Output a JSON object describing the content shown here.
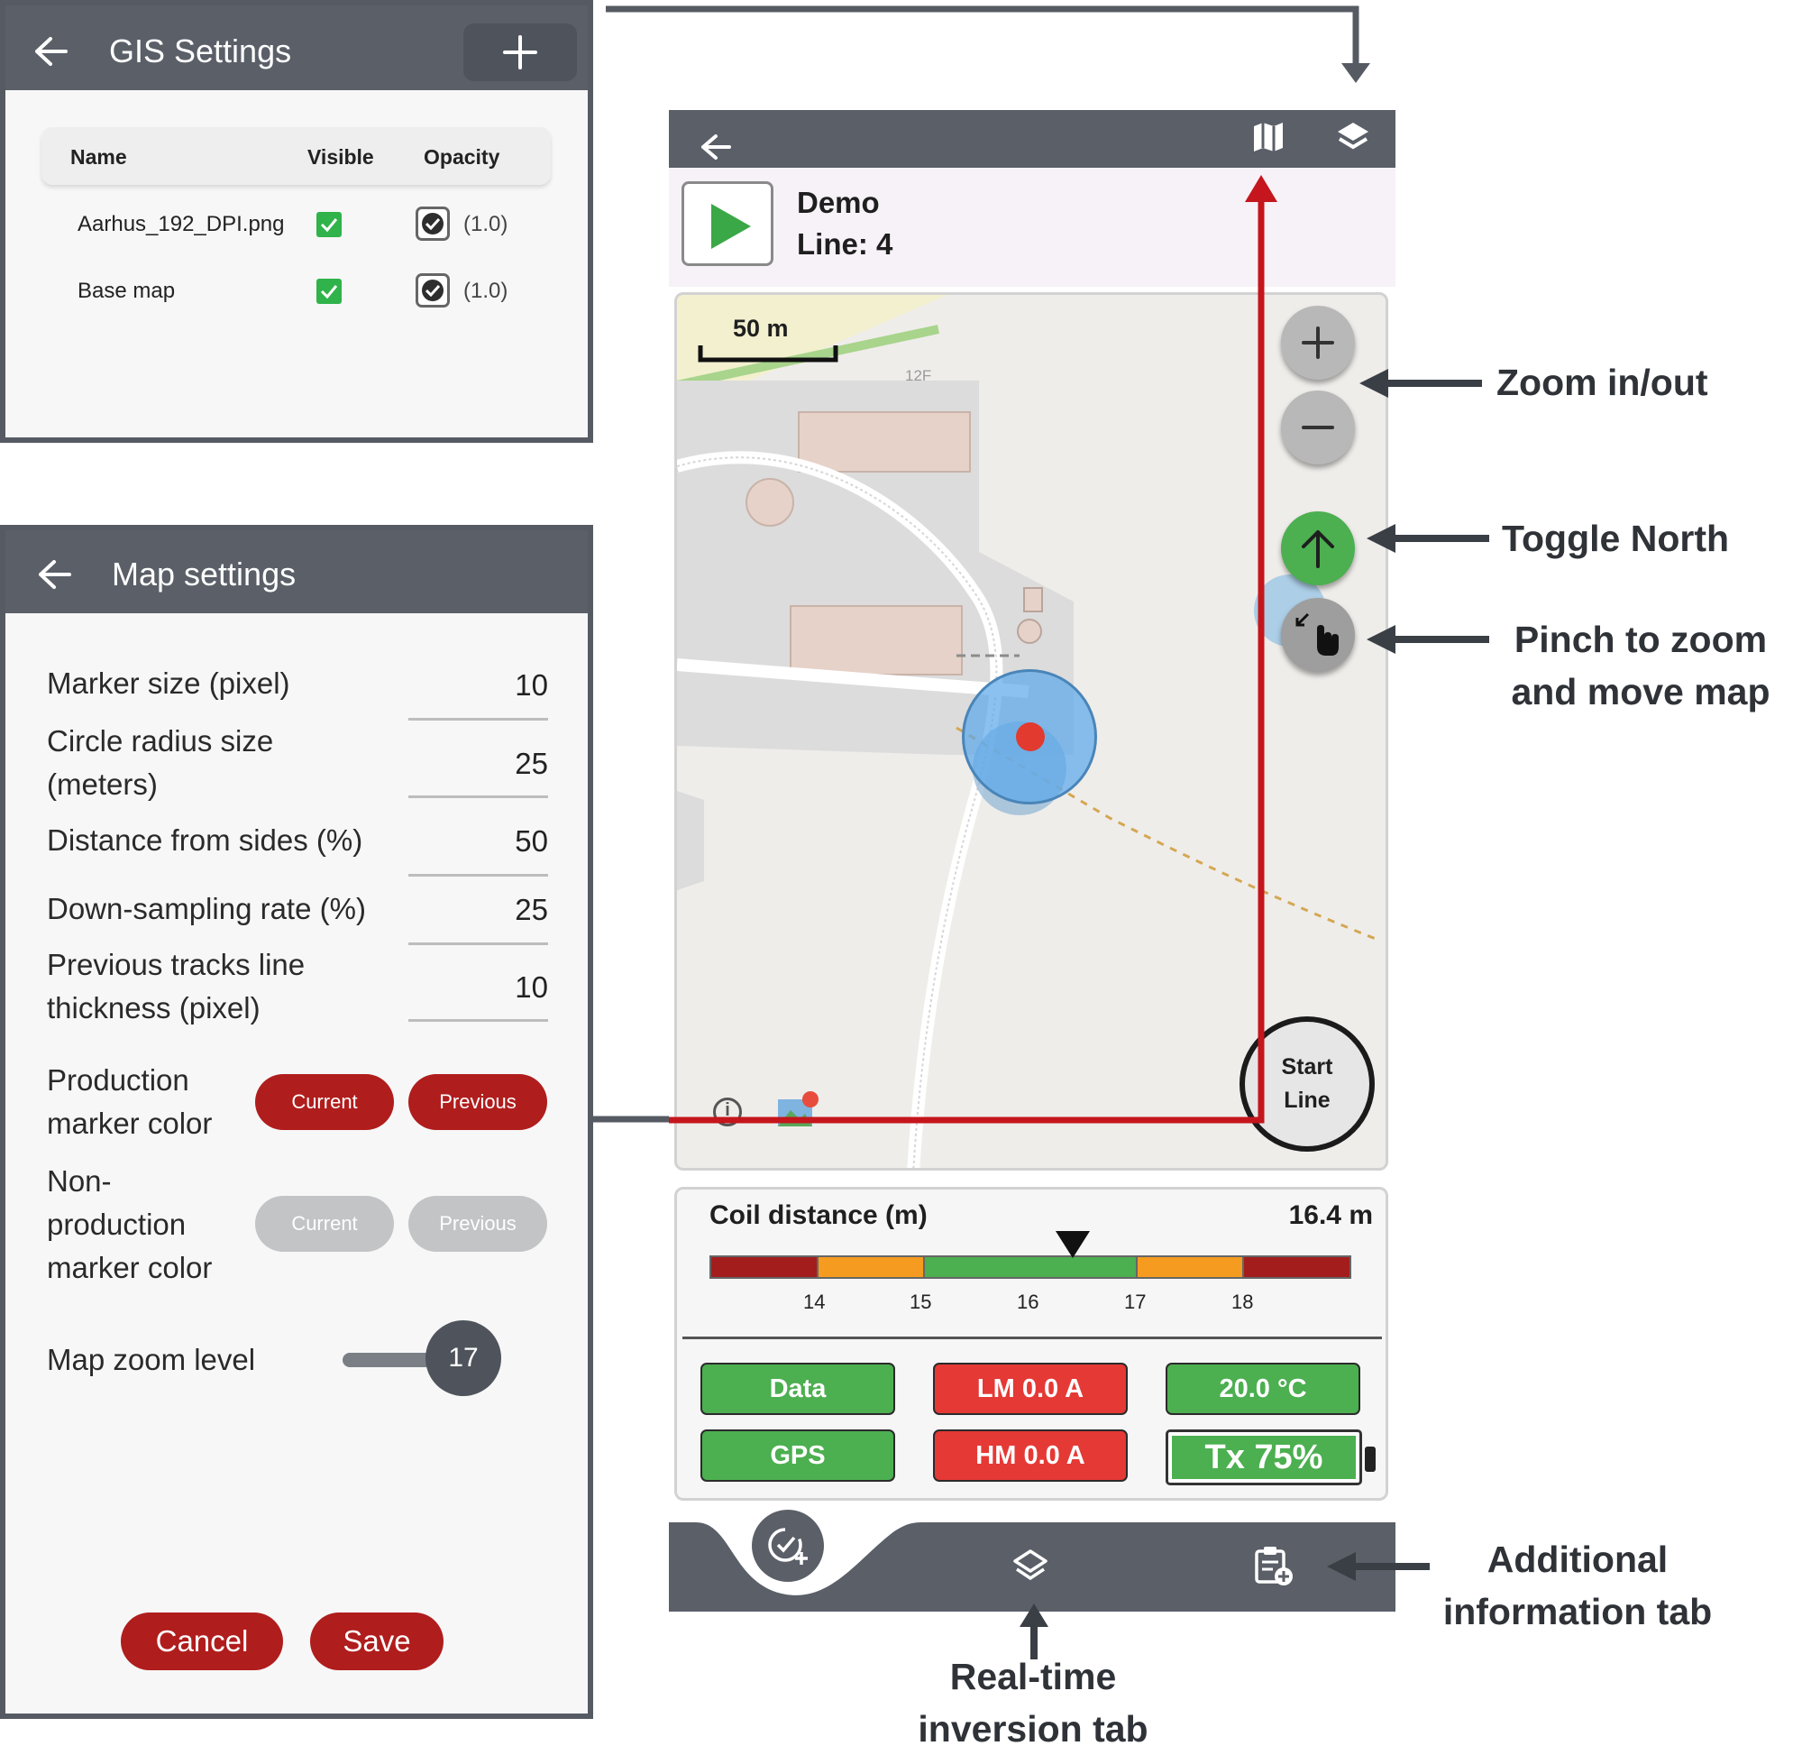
{
  "gis": {
    "title": "GIS Settings",
    "add_icon": "plus-icon",
    "columns": [
      "Name",
      "Visible",
      "Opacity"
    ],
    "layers": [
      {
        "name": "Aarhus_192_DPI.png",
        "visible": true,
        "opacity": "(1.0)"
      },
      {
        "name": "Base map",
        "visible": true,
        "opacity": "(1.0)"
      }
    ]
  },
  "map_settings": {
    "title": "Map settings",
    "fields": [
      {
        "label": "Marker size (pixel)",
        "value": "10"
      },
      {
        "label": "Circle radius size (meters)",
        "value": "25"
      },
      {
        "label": "Distance from sides (%)",
        "value": "50"
      },
      {
        "label": "Down-sampling rate (%)",
        "value": "25"
      },
      {
        "label": "Previous tracks line thickness (pixel)",
        "value": "10"
      }
    ],
    "production_label": "Production marker color",
    "nonproduction_label": "Non-production marker color",
    "current_label": "Current",
    "previous_label": "Previous",
    "zoom_label": "Map zoom level",
    "zoom_value": "17",
    "zoom_fraction": 1.0,
    "cancel_label": "Cancel",
    "save_label": "Save",
    "colors": {
      "production": "#b01d1d",
      "nonproduction": "#c2c4c6"
    }
  },
  "app": {
    "survey_name": "Demo",
    "line_label": "Line: 4",
    "scale_label": "50 m",
    "map_label": "12F",
    "start_line_label": "Start Line",
    "coil_label": "Coil distance (m)",
    "coil_value": "16.4 m",
    "coil_ticks": [
      "14",
      "15",
      "16",
      "17",
      "18"
    ],
    "coil_reading": 16.4,
    "coil_range": [
      13,
      19
    ],
    "status": {
      "data": "Data",
      "gps": "GPS",
      "lm": "LM 0.0 A",
      "hm": "HM 0.0 A",
      "temp": "20.0 °C",
      "tx": "Tx 75%"
    },
    "colors": {
      "ok": "#4caf50",
      "error": "#e53935",
      "header": "#5a5f68"
    }
  },
  "annotations": {
    "zoom": "Zoom in/out",
    "north": "Toggle North",
    "pinch": "Pinch to zoom and move map",
    "additional": "Additional information tab",
    "realtime": "Real-time inversion tab"
  }
}
